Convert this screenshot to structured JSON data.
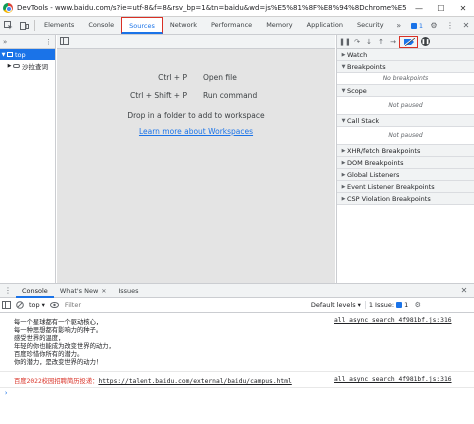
{
  "window": {
    "title": "DevTools - www.baidu.com/s?ie=utf-8&f=8&rsv_bp=1&tn=baidu&wd=js%E5%81%8F%E8%94%8Dchrome%E5%F12%...",
    "minimize": "—",
    "maximize": "☐",
    "close": "✕"
  },
  "tabs": [
    "Elements",
    "Console",
    "Sources",
    "Network",
    "Performance",
    "Memory",
    "Application",
    "Security"
  ],
  "active_tab": "Sources",
  "tabbar": {
    "more": "»",
    "issues_count": "1",
    "settings_glyph": "⚙",
    "menu_glyph": "⋮",
    "close_glyph": "✕"
  },
  "navigator": {
    "more": "»",
    "menu": "⋮",
    "top": "top",
    "child": "沙拉查词"
  },
  "editor": {
    "shortcuts": [
      {
        "keys": "Ctrl + P",
        "action": "Open file"
      },
      {
        "keys": "Ctrl + Shift + P",
        "action": "Run command"
      }
    ],
    "drop_text": "Drop in a folder to add to workspace",
    "learn_link": "Learn more about Workspaces"
  },
  "debugger": {
    "toolbar": [
      "❚❚",
      "↷",
      "↓",
      "↑",
      "→"
    ],
    "panes": [
      {
        "title": "Watch",
        "body": ""
      },
      {
        "title": "Breakpoints",
        "body": "No breakpoints"
      },
      {
        "title": "Scope",
        "body": "Not paused"
      },
      {
        "title": "Call Stack",
        "body": "Not paused"
      },
      {
        "title": "XHR/fetch Breakpoints",
        "body": ""
      },
      {
        "title": "DOM Breakpoints",
        "body": ""
      },
      {
        "title": "Global Listeners",
        "body": ""
      },
      {
        "title": "Event Listener Breakpoints",
        "body": ""
      },
      {
        "title": "CSP Violation Breakpoints",
        "body": ""
      }
    ]
  },
  "drawer": {
    "tabs": [
      "Console",
      "What's New",
      "Issues"
    ],
    "close": "✕",
    "context": "top",
    "filter_placeholder": "Filter",
    "levels": "Default levels",
    "issue_label": "1 Issue:",
    "issue_count": "1"
  },
  "console": {
    "lines": [
      "每一个星球都有一个驱动核心，",
      "每一种思想都有影响力的种子。",
      "感受世界的温度，",
      "年轻的你也能成为改变世界的动力，",
      "百度珍惜你所有的潜力。",
      "你的潜力，是改变世界的动力！"
    ],
    "source1": "all_async_search_4f981bf.js:316",
    "recruit_text": "百度2022校园招聘简历投递：",
    "recruit_url": "https://talent.baidu.com/external/baidu/campus.html",
    "source2": "all_async_search_4f981bf.js:316",
    "prompt": "›"
  }
}
